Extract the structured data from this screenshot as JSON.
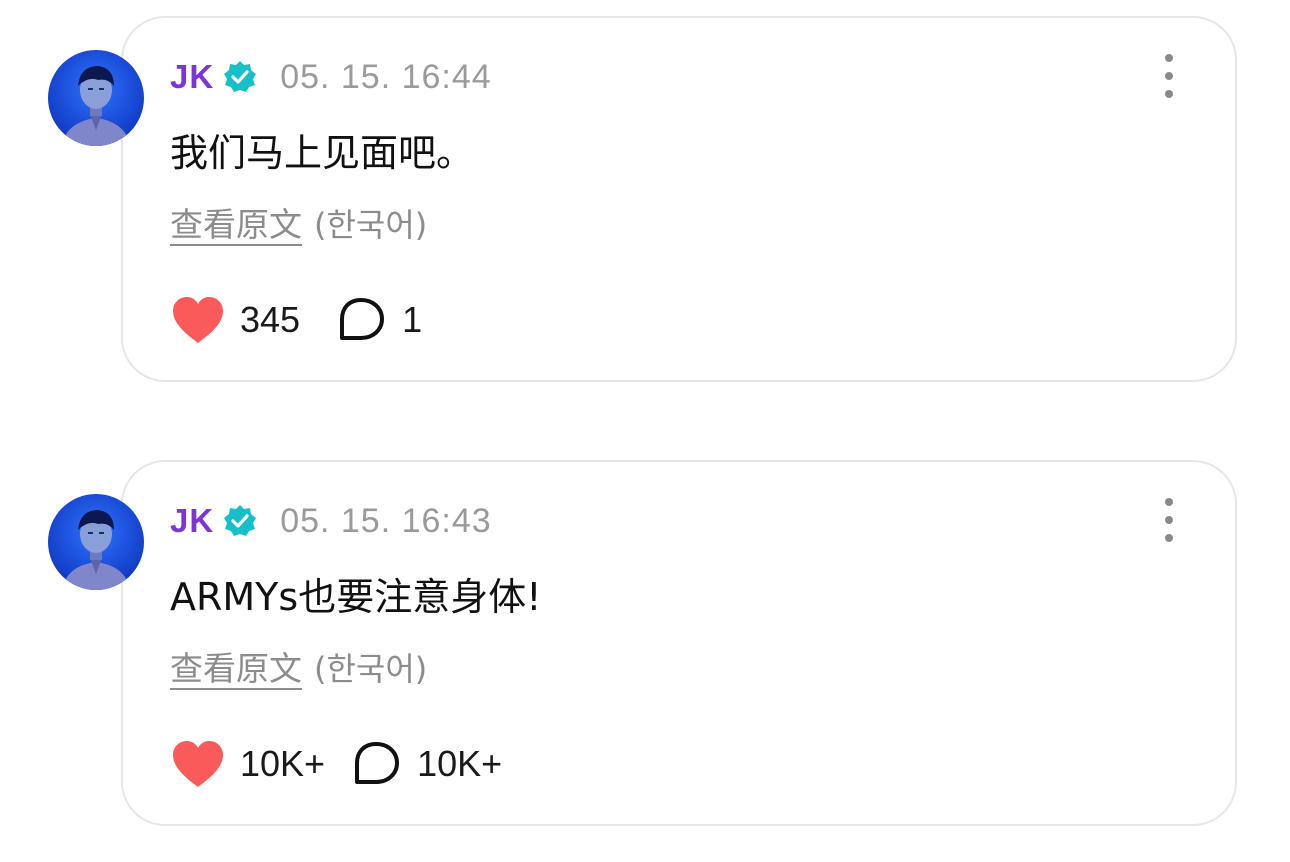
{
  "colors": {
    "author": "#7b35d8",
    "verified_badge": "#17c0c8",
    "heart": "#fa5a5a",
    "muted_text": "#9a9a9a"
  },
  "posts": [
    {
      "author": "JK",
      "verified": true,
      "timestamp": "05. 15. 16:44",
      "text": "我们马上见面吧。",
      "see_original": "查看原文",
      "original_language": "(한국어)",
      "likes": "345",
      "comments": "1",
      "icons": [
        "verified-badge-icon",
        "more-options-icon",
        "heart-icon",
        "comment-icon"
      ]
    },
    {
      "author": "JK",
      "verified": true,
      "timestamp": "05. 15. 16:43",
      "text": "ARMYs也要注意身体!",
      "see_original": "查看原文",
      "original_language": "(한국어)",
      "likes": "10K+",
      "comments": "10K+",
      "icons": [
        "verified-badge-icon",
        "more-options-icon",
        "heart-icon",
        "comment-icon"
      ]
    }
  ]
}
